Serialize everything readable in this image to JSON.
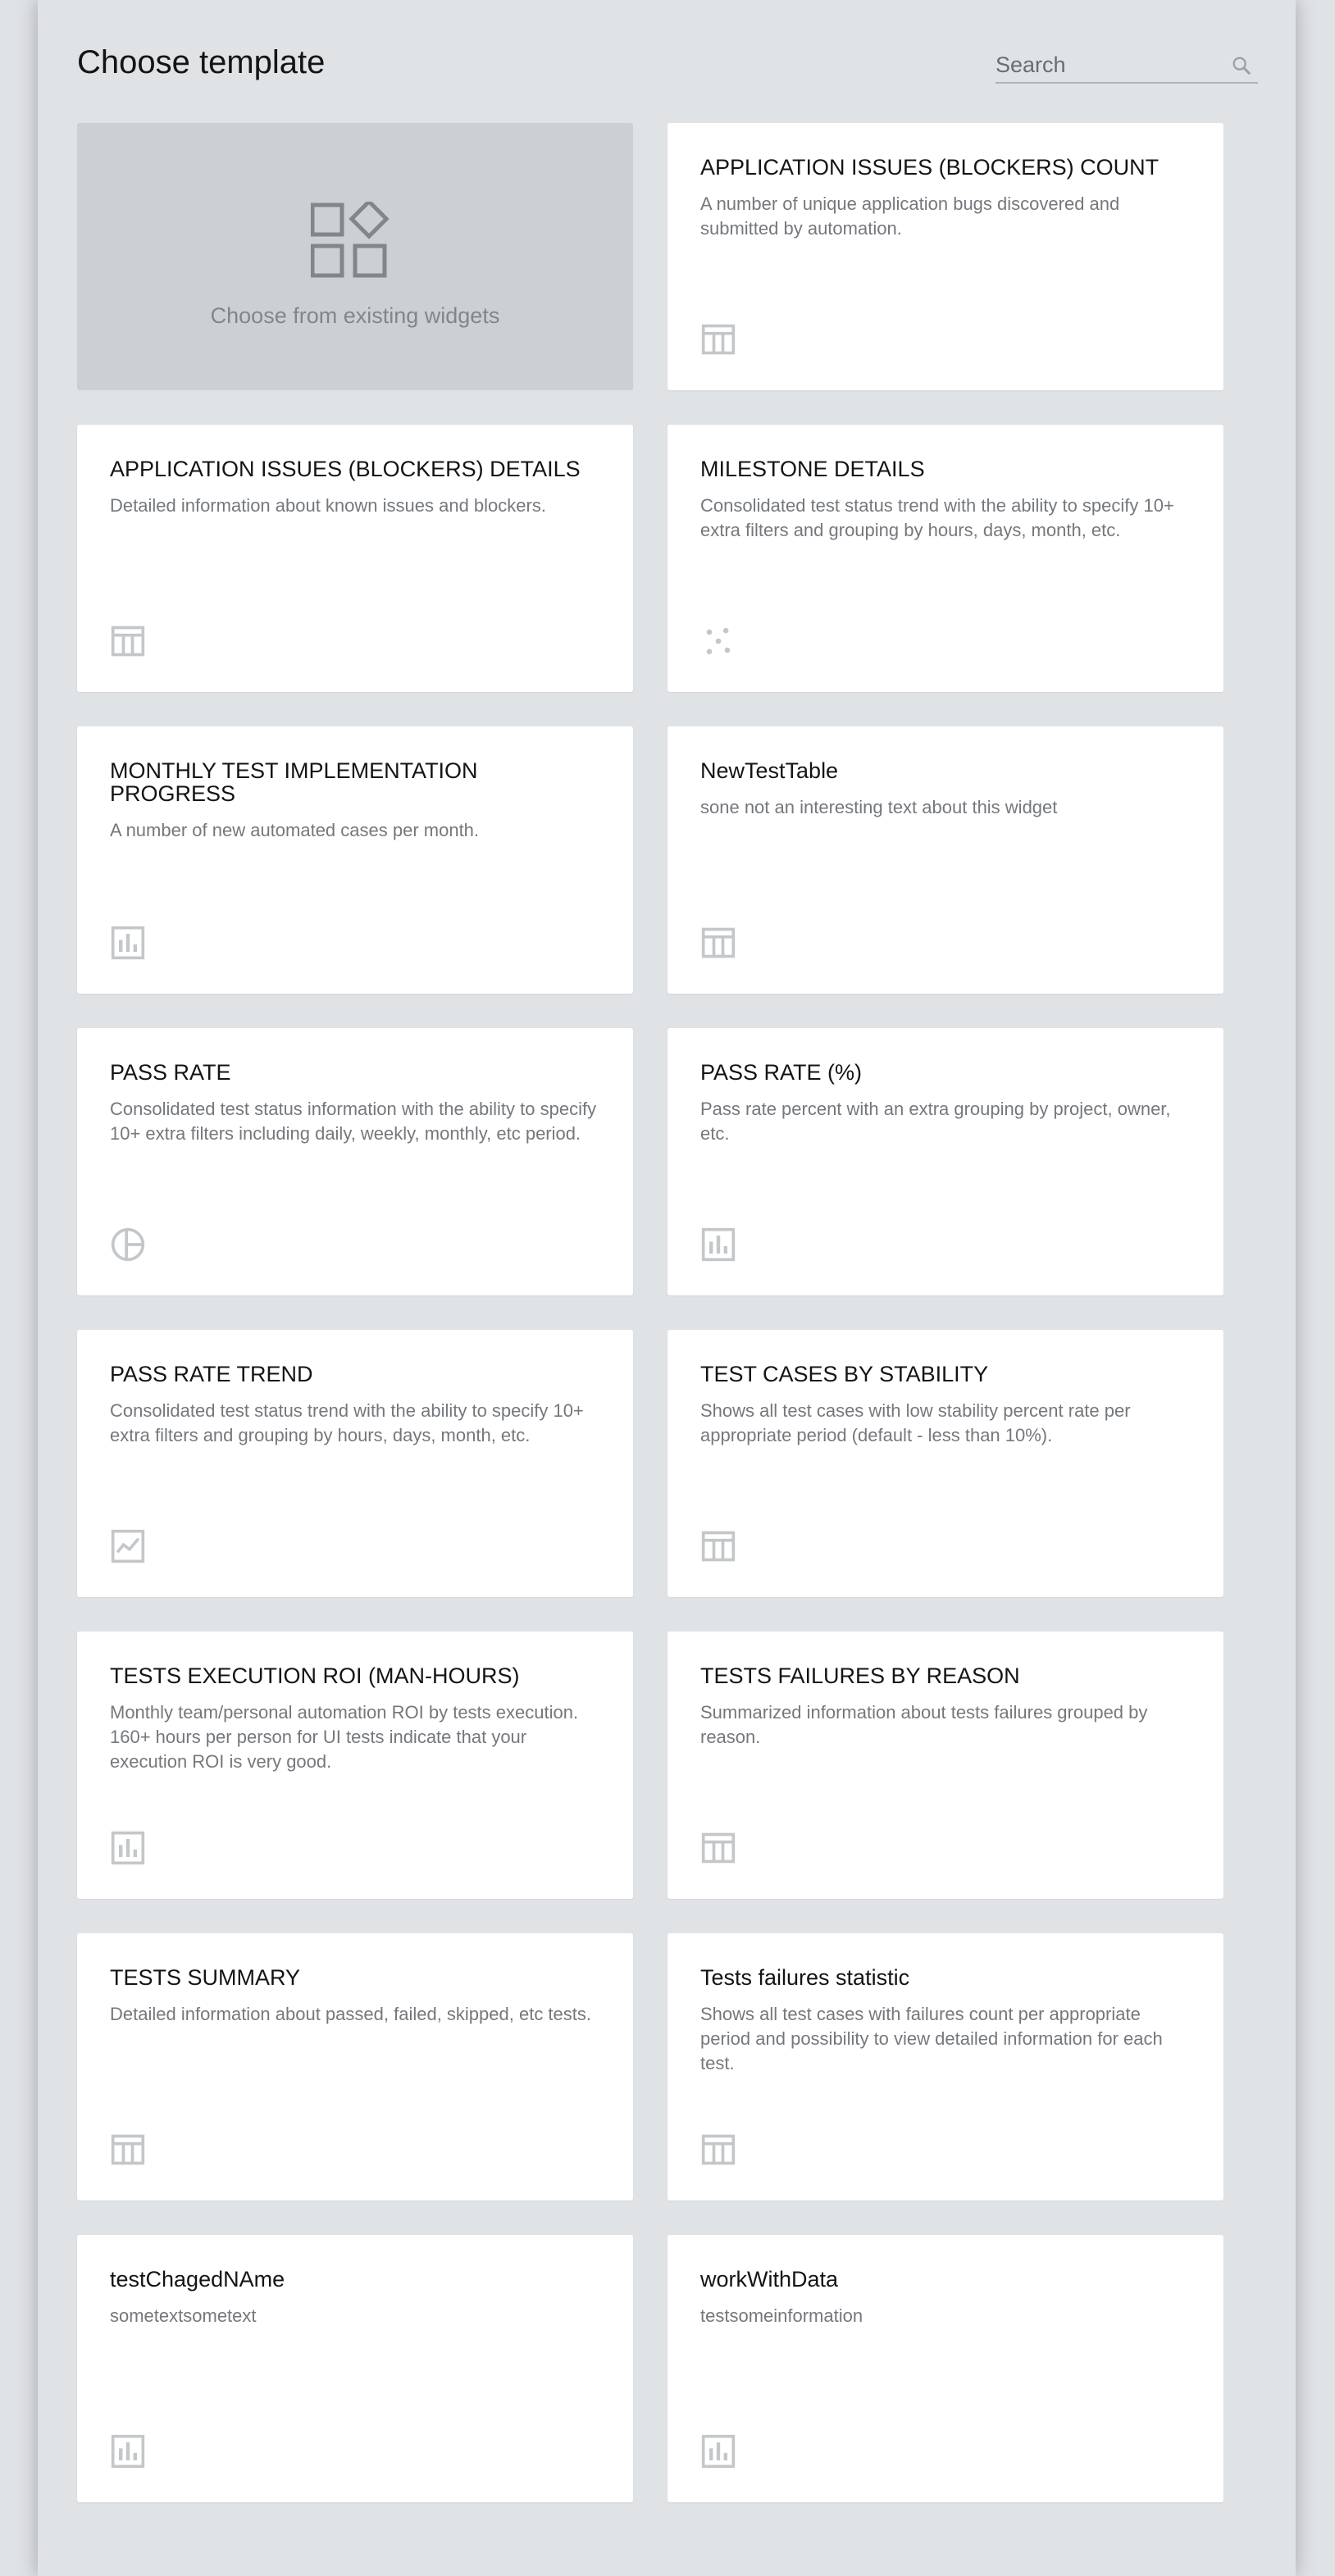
{
  "dialog": {
    "title": "Choose template",
    "search": {
      "placeholder": "Search",
      "value": ""
    }
  },
  "existing": {
    "label": "Choose from existing widgets",
    "icon": "widgets-icon"
  },
  "cards": [
    {
      "title": "APPLICATION ISSUES (BLOCKERS) COUNT",
      "description": "A number of unique application bugs discovered and submitted by automation.",
      "icon": "table-icon"
    },
    {
      "title": "APPLICATION ISSUES (BLOCKERS) DETAILS",
      "description": "Detailed information about known issues and blockers.",
      "icon": "table-icon"
    },
    {
      "title": "MILESTONE DETAILS",
      "description": "Consolidated test status trend with the ability to specify 10+ extra filters and grouping by hours, days, month, etc.",
      "icon": "scatter-icon"
    },
    {
      "title": "MONTHLY TEST IMPLEMENTATION PROGRESS",
      "description": "A number of new automated cases per month.",
      "icon": "bar-chart-icon"
    },
    {
      "title": "NewTestTable",
      "description": "sone not an interesting text about this widget",
      "icon": "table-icon"
    },
    {
      "title": "PASS RATE",
      "description": "Consolidated test status information with the ability to specify 10+ extra filters including daily, weekly, monthly, etc period.",
      "icon": "pie-chart-icon"
    },
    {
      "title": "PASS RATE (%)",
      "description": "Pass rate percent with an extra grouping by project, owner, etc.",
      "icon": "bar-chart-icon"
    },
    {
      "title": "PASS RATE TREND",
      "description": "Consolidated test status trend with the ability to specify 10+ extra filters and grouping by hours, days, month, etc.",
      "icon": "line-chart-icon"
    },
    {
      "title": "TEST CASES BY STABILITY",
      "description": "Shows all test cases with low stability percent rate per appropriate period (default - less than 10%).",
      "icon": "table-icon"
    },
    {
      "title": "TESTS EXECUTION ROI (MAN-HOURS)",
      "description": "Monthly team/personal automation ROI by tests execution. 160+ hours per person for UI tests indicate that your execution ROI is very good.",
      "icon": "bar-chart-icon"
    },
    {
      "title": "TESTS FAILURES BY REASON",
      "description": "Summarized information about tests failures grouped by reason.",
      "icon": "table-icon"
    },
    {
      "title": "TESTS SUMMARY",
      "description": "Detailed information about passed, failed, skipped, etc tests.",
      "icon": "table-icon"
    },
    {
      "title": "Tests failures statistic",
      "description": "Shows all test cases with failures count per appropriate period and possibility to view detailed information for each test.",
      "icon": "table-icon"
    },
    {
      "title": "testChagedNAme",
      "description": "sometextsometext",
      "icon": "bar-chart-icon"
    },
    {
      "title": "workWithData",
      "description": "testsomeinformation",
      "icon": "bar-chart-icon"
    }
  ],
  "colors": {
    "background": "#e0e3e6",
    "card": "#ffffff",
    "existing_card": "#cbd0d3",
    "icon_gray": "#c4c7ca"
  }
}
